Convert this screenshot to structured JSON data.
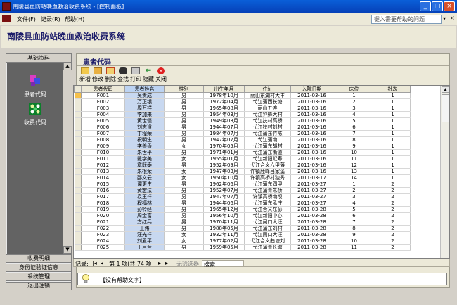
{
  "window": {
    "title": "南陵县血防站晚血救治收费系统 - [控制面板]"
  },
  "menu": {
    "file": "文件(F)",
    "records": "记录(R)",
    "help": "帮助(H)"
  },
  "helpbox": {
    "placeholder": "键入需要帮助的问题"
  },
  "app": {
    "title": "南陵县血防站晚血救治收费系统"
  },
  "sidebar": {
    "tab": "基础资料",
    "items": [
      {
        "label": "患者代码",
        "icon": "patient-code-icon"
      },
      {
        "label": "收费代码",
        "icon": "fee-code-icon"
      }
    ],
    "buttons": [
      "收费明细",
      "身份证验证信息",
      "系统管理",
      "退出注销"
    ]
  },
  "form": {
    "title": "患者代码"
  },
  "toolbar": [
    {
      "key": "new",
      "label": "新增"
    },
    {
      "key": "edit",
      "label": "修改"
    },
    {
      "key": "delete",
      "label": "删除"
    },
    {
      "key": "find",
      "label": "查找"
    },
    {
      "key": "print",
      "label": "打印"
    },
    {
      "key": "hide",
      "label": "隐藏"
    },
    {
      "key": "close",
      "label": "关闭"
    }
  ],
  "grid": {
    "columns": [
      "患者代码",
      "患者姓名",
      "性别",
      "出生年月",
      "住址",
      "入院日期",
      "床位",
      "批次"
    ],
    "rows": [
      [
        "F001",
        "吴贵成",
        "男",
        "1978年10月",
        "丽山东湖村大丰",
        "2011-03-16",
        "1",
        "1"
      ],
      [
        "F002",
        "万正银",
        "男",
        "1972年04月",
        "弋江蒲西长塘",
        "2011-03-16",
        "2",
        "1"
      ],
      [
        "F003",
        "周万祥",
        "男",
        "1965年08月",
        "丽山五连",
        "2011-03-16",
        "3",
        "1"
      ],
      [
        "F004",
        "李加来",
        "男",
        "1954年03月",
        "弋江钟蜂大村",
        "2011-03-16",
        "4",
        "1"
      ],
      [
        "F005",
        "黄世儒",
        "男",
        "1949年03月",
        "弋江扶村高桥",
        "2011-03-16",
        "5",
        "1"
      ],
      [
        "F006",
        "刘志道",
        "男",
        "1944年07月",
        "弋江扶村刘村",
        "2011-03-16",
        "6",
        "1"
      ],
      [
        "F007",
        "丁程荣",
        "男",
        "1984年07月",
        "弋江蒲东竹陈",
        "2011-03-16",
        "7",
        "1"
      ],
      [
        "F008",
        "祝明生",
        "男",
        "1947年07月",
        "弋江蒲南",
        "2011-03-16",
        "8",
        "1"
      ],
      [
        "F009",
        "李善香",
        "女",
        "1970年05月",
        "弋江蒲东胡村",
        "2011-03-16",
        "9",
        "1"
      ],
      [
        "F010",
        "朱世平",
        "男",
        "1971年01月",
        "弋江蒲东街道",
        "2011-03-16",
        "10",
        "1"
      ],
      [
        "F011",
        "戴学美",
        "女",
        "1955年01月",
        "弋江新阳延寿",
        "2011-03-16",
        "11",
        "1"
      ],
      [
        "F012",
        "章既泰",
        "男",
        "1952年09月",
        "弋江合义六甲藩",
        "2011-03-16",
        "12",
        "1"
      ],
      [
        "F013",
        "朱根荣",
        "女",
        "1947年03月",
        "许镇鹿峰吕家溪",
        "2011-03-16",
        "13",
        "1"
      ],
      [
        "F014",
        "邵文云",
        "女",
        "1950年10月",
        "许镇高桥村独秀",
        "2011-03-17",
        "14",
        "1"
      ],
      [
        "F015",
        "谭更生",
        "男",
        "1962年06月",
        "弋江蒲东四甲",
        "2011-03-27",
        "1",
        "2"
      ],
      [
        "F016",
        "黄宏法",
        "男",
        "1952年07月",
        "弋江蒲青朱桥",
        "2011-03-27",
        "2",
        "2"
      ],
      [
        "F017",
        "袁玉祥",
        "男",
        "1947年07月",
        "许镇高桥南坝",
        "2011-03-27",
        "3",
        "2"
      ],
      [
        "F018",
        "程福林",
        "男",
        "1944年06月",
        "弋江蒲东孟庄",
        "2011-03-27",
        "4",
        "2"
      ],
      [
        "F019",
        "彭铃经",
        "男",
        "1965年12月",
        "弋江合义东彭",
        "2011-03-28",
        "5",
        "2"
      ],
      [
        "F020",
        "周金富",
        "男",
        "1956年10月",
        "弋江新阳中心",
        "2011-03-28",
        "6",
        "2"
      ],
      [
        "F021",
        "方红兵",
        "男",
        "1970年11月",
        "弋江闸口大汪",
        "2011-03-28",
        "7",
        "2"
      ],
      [
        "F022",
        "王伟",
        "男",
        "1988年05月",
        "弋江蒲东刘村",
        "2011-03-28",
        "8",
        "2"
      ],
      [
        "F023",
        "汪光祥",
        "女",
        "1932年11月",
        "弋江闸口大汪",
        "2011-03-28",
        "9",
        "2"
      ],
      [
        "F024",
        "刘爱平",
        "女",
        "1977年02月",
        "弋江合义曲塘刘",
        "2011-03-28",
        "10",
        "2"
      ],
      [
        "F025",
        "王月兰",
        "男",
        "1959年05月",
        "弋江蒲青长塘",
        "2011-03-28",
        "11",
        "2"
      ]
    ]
  },
  "recordnav": {
    "label": "记录:",
    "position": "第 1 项(共 74 项",
    "filter": "无筛选器",
    "search": "搜索"
  },
  "status": {
    "text": "【没有帮助文字】"
  }
}
